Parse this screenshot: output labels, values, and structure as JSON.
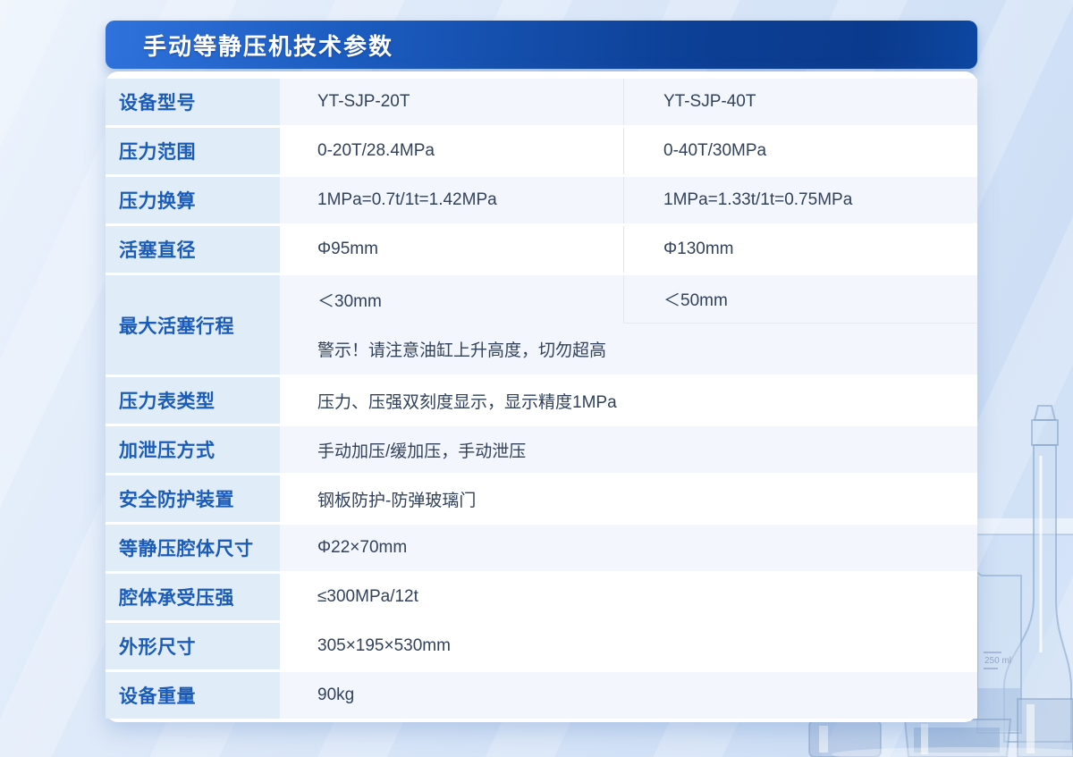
{
  "header": {
    "title": "手动等静压机技术参数"
  },
  "table": {
    "rows": [
      {
        "label": "设备型号",
        "col1": "YT-SJP-20T",
        "col2": "YT-SJP-40T"
      },
      {
        "label": "压力范围",
        "col1": "0-20T/28.4MPa",
        "col2": "0-40T/30MPa"
      },
      {
        "label": "压力换算",
        "col1": "1MPa=0.7t/1t=1.42MPa",
        "col2": "1MPa=1.33t/1t=0.75MPa"
      },
      {
        "label": "活塞直径",
        "col1": "Φ95mm",
        "col2": "Φ130mm"
      },
      {
        "label": "最大活塞行程",
        "col1": "＜30mm",
        "col2": "＜50mm",
        "note": "警示！请注意油缸上升高度，切勿超高"
      },
      {
        "label": "压力表类型",
        "value": "压力、压强双刻度显示，显示精度1MPa"
      },
      {
        "label": "加泄压方式",
        "value": "手动加压/缓加压，手动泄压"
      },
      {
        "label": "安全防护装置",
        "value": "钢板防护-防弹玻璃门"
      },
      {
        "label": "等静压腔体尺寸",
        "value": "Φ22×70mm"
      },
      {
        "label": "腔体承受压强",
        "value": "≤300MPa/12t"
      },
      {
        "label": "外形尺寸",
        "value": "305×195×530mm"
      },
      {
        "label": "设备重量",
        "value": "90kg"
      }
    ]
  },
  "background": {
    "beaker_marking": "250 ml"
  },
  "colors": {
    "header_gradient_start": "#2f72dc",
    "header_gradient_end": "#0a3a8c",
    "label_text": "#1b5cb8",
    "value_text": "#32415c",
    "label_cell_bg": "#e1ecf9",
    "stripe_bg": "#f3f7fd",
    "page_bg": "#d6e4f7"
  }
}
